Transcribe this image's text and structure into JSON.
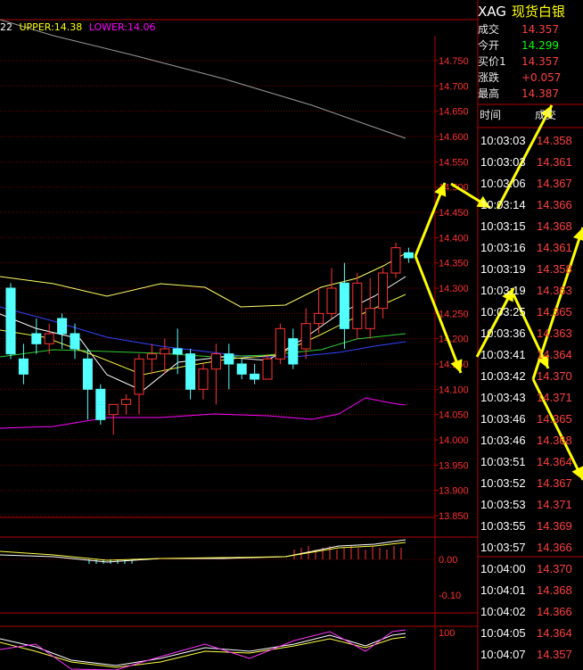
{
  "indicator": {
    "mid_value": "22",
    "upper_label": "UPPER:14.38",
    "lower_label": "LOWER:14.06",
    "upper_color": "#ffff00",
    "lower_color": "#ff00ff"
  },
  "price_axis": {
    "ticks": [
      "14.750",
      "14.700",
      "14.650",
      "14.600",
      "14.550",
      "14.500",
      "14.450",
      "14.400",
      "14.350",
      "14.300",
      "14.250",
      "14.200",
      "14.150",
      "14.100",
      "14.050",
      "14.000",
      "13.950",
      "13.900",
      "13.850"
    ]
  },
  "macd_axis": {
    "ticks": [
      "0.00",
      "-0.10"
    ]
  },
  "kdj_axis": {
    "ticks": [
      "100"
    ]
  },
  "quote": {
    "symbol": "XAG",
    "name": "现货白银",
    "rows": [
      {
        "key": "成交",
        "value": "14.357",
        "color": "#ff4040"
      },
      {
        "key": "今开",
        "value": "14.299",
        "color": "#00ff00"
      },
      {
        "key": "买价1",
        "value": "14.357",
        "color": "#ff4040"
      },
      {
        "key": "涨跌",
        "value": "+0.057",
        "color": "#ff4040"
      },
      {
        "key": "最高",
        "value": "14.387",
        "color": "#ff4040"
      }
    ]
  },
  "ticks_table": {
    "header_time": "时间",
    "header_price": "成交",
    "rows": [
      {
        "time": "10:03:03",
        "price": "14.358"
      },
      {
        "time": "10:03:03",
        "price": "14.361"
      },
      {
        "time": "10:03:06",
        "price": "14.367"
      },
      {
        "time": "10:03:14",
        "price": "14.366"
      },
      {
        "time": "10:03:15",
        "price": "14.368"
      },
      {
        "time": "10:03:16",
        "price": "14.361"
      },
      {
        "time": "10:03:19",
        "price": "14.358"
      },
      {
        "time": "10:03:19",
        "price": "14.363"
      },
      {
        "time": "10:03:25",
        "price": "14.365"
      },
      {
        "time": "10:03:36",
        "price": "14.363"
      },
      {
        "time": "10:03:41",
        "price": "14.364"
      },
      {
        "time": "10:03:42",
        "price": "14.370"
      },
      {
        "time": "10:03:43",
        "price": "14.371"
      },
      {
        "time": "10:03:46",
        "price": "14.365"
      },
      {
        "time": "10:03:46",
        "price": "14.368"
      },
      {
        "time": "10:03:51",
        "price": "14.364"
      },
      {
        "time": "10:03:52",
        "price": "14.367"
      },
      {
        "time": "10:03:53",
        "price": "14.371"
      },
      {
        "time": "10:03:55",
        "price": "14.369"
      },
      {
        "time": "10:03:57",
        "price": "14.366"
      },
      {
        "time": "10:04:00",
        "price": "14.370"
      },
      {
        "time": "10:04:01",
        "price": "14.368"
      },
      {
        "time": "10:04:02",
        "price": "14.366"
      },
      {
        "time": "10:04:05",
        "price": "14.364"
      },
      {
        "time": "10:04:07",
        "price": "14.357"
      }
    ]
  },
  "chart_data": {
    "type": "candlestick",
    "y_range": [
      13.85,
      14.78
    ],
    "candles": [
      {
        "o": 14.3,
        "c": 14.17,
        "h": 14.31,
        "l": 14.16
      },
      {
        "o": 14.16,
        "c": 14.13,
        "h": 14.19,
        "l": 14.11
      },
      {
        "o": 14.21,
        "c": 14.19,
        "h": 14.24,
        "l": 14.17
      },
      {
        "o": 14.19,
        "c": 14.21,
        "h": 14.23,
        "l": 14.17
      },
      {
        "o": 14.24,
        "c": 14.21,
        "h": 14.25,
        "l": 14.18
      },
      {
        "o": 14.21,
        "c": 14.18,
        "h": 14.23,
        "l": 14.16
      },
      {
        "o": 14.16,
        "c": 14.1,
        "h": 14.18,
        "l": 14.04
      },
      {
        "o": 14.1,
        "c": 14.04,
        "h": 14.11,
        "l": 14.03
      },
      {
        "o": 14.05,
        "c": 14.07,
        "h": 14.07,
        "l": 14.01
      },
      {
        "o": 14.07,
        "c": 14.08,
        "h": 14.09,
        "l": 14.05
      },
      {
        "o": 14.09,
        "c": 14.16,
        "h": 14.17,
        "l": 14.05
      },
      {
        "o": 14.16,
        "c": 14.17,
        "h": 14.19,
        "l": 14.13
      },
      {
        "o": 14.17,
        "c": 14.18,
        "h": 14.2,
        "l": 14.13
      },
      {
        "o": 14.18,
        "c": 14.17,
        "h": 14.22,
        "l": 14.13
      },
      {
        "o": 14.17,
        "c": 14.1,
        "h": 14.18,
        "l": 14.08
      },
      {
        "o": 14.1,
        "c": 14.14,
        "h": 14.15,
        "l": 14.08
      },
      {
        "o": 14.14,
        "c": 14.17,
        "h": 14.19,
        "l": 14.07
      },
      {
        "o": 14.17,
        "c": 14.15,
        "h": 14.19,
        "l": 14.1
      },
      {
        "o": 14.15,
        "c": 14.13,
        "h": 14.16,
        "l": 14.12
      },
      {
        "o": 14.13,
        "c": 14.12,
        "h": 14.15,
        "l": 14.11
      },
      {
        "o": 14.12,
        "c": 14.16,
        "h": 14.17,
        "l": 14.12
      },
      {
        "o": 14.16,
        "c": 14.22,
        "h": 14.23,
        "l": 14.15
      },
      {
        "o": 14.2,
        "c": 14.15,
        "h": 14.22,
        "l": 14.14
      },
      {
        "o": 14.18,
        "c": 14.23,
        "h": 14.26,
        "l": 14.16
      },
      {
        "o": 14.23,
        "c": 14.25,
        "h": 14.3,
        "l": 14.21
      },
      {
        "o": 14.25,
        "c": 14.3,
        "h": 14.34,
        "l": 14.24
      },
      {
        "o": 14.31,
        "c": 14.22,
        "h": 14.35,
        "l": 14.18
      },
      {
        "o": 14.22,
        "c": 14.31,
        "h": 14.33,
        "l": 14.2
      },
      {
        "o": 14.22,
        "c": 14.26,
        "h": 14.32,
        "l": 14.2
      },
      {
        "o": 14.26,
        "c": 14.33,
        "h": 14.34,
        "l": 14.24
      },
      {
        "o": 14.33,
        "c": 14.38,
        "h": 14.39,
        "l": 14.32
      },
      {
        "o": 14.37,
        "c": 14.36,
        "h": 14.38,
        "l": 14.35
      }
    ],
    "price_axis_ticks": [
      14.75,
      14.7,
      14.65,
      14.6,
      14.55,
      14.5,
      14.45,
      14.4,
      14.35,
      14.3,
      14.25,
      14.2,
      14.15,
      14.1,
      14.05,
      14.0,
      13.95,
      13.9,
      13.85
    ],
    "grid": true
  }
}
